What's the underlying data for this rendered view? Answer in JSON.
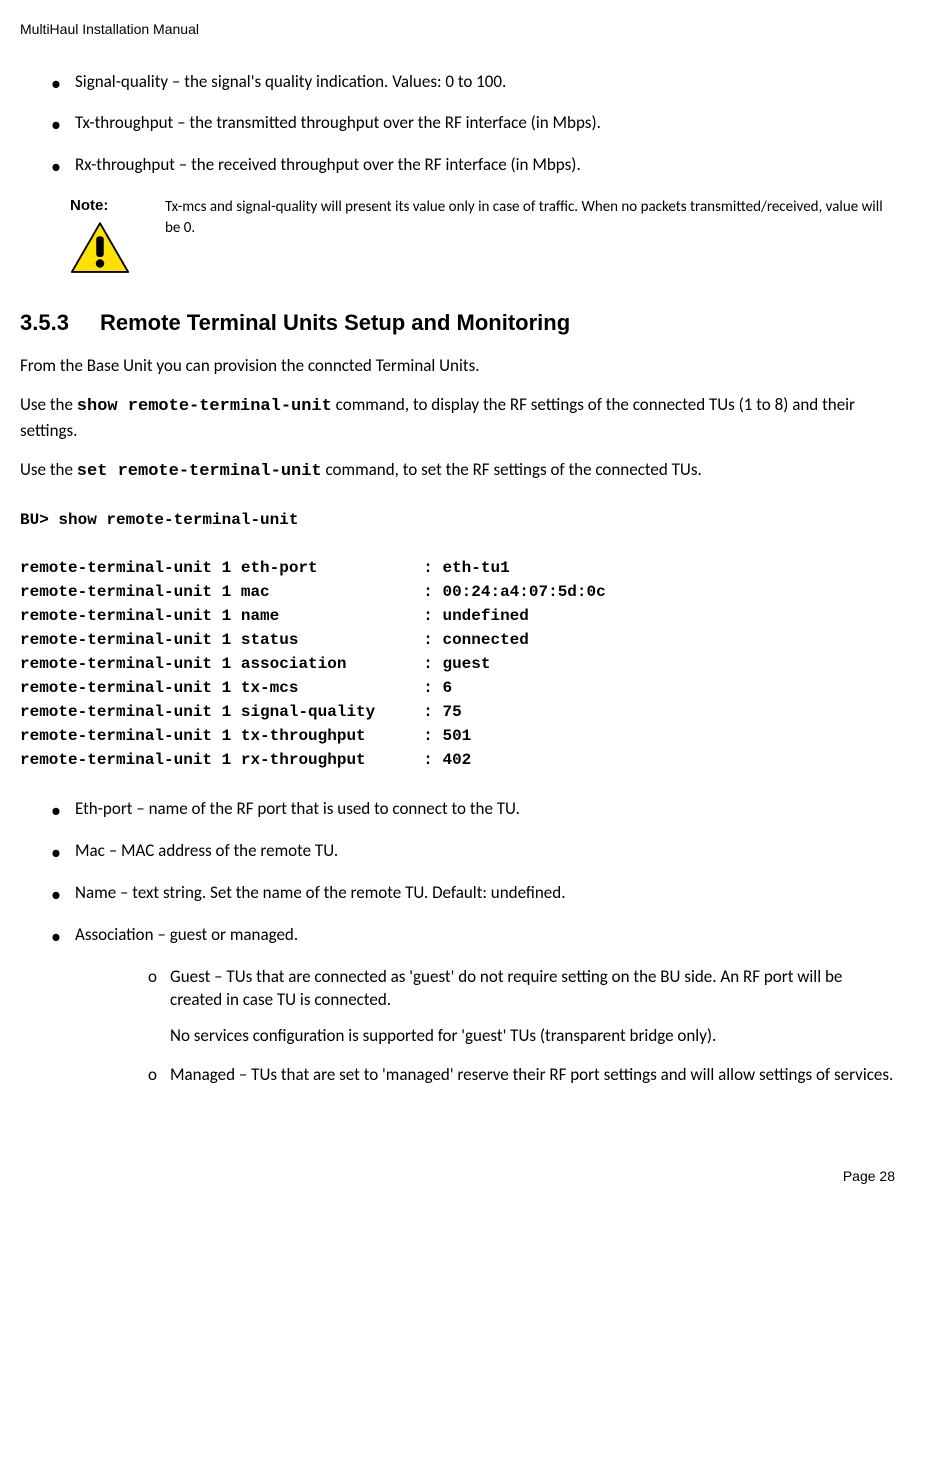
{
  "header": "MultiHaul Installation Manual",
  "top_bullets": [
    "Signal-quality – the signal's quality indication. Values: 0 to 100.",
    "Tx-throughput – the transmitted throughput over the RF interface (in Mbps).",
    "Rx-throughput – the received throughput over the RF interface (in Mbps)."
  ],
  "note": {
    "label": "Note:",
    "text": "Tx-mcs and signal-quality will present its value only in case of traffic. When no packets transmitted/received, value will be 0."
  },
  "section": {
    "number": "3.5.3",
    "title": "Remote Terminal Units Setup and Monitoring"
  },
  "paragraphs": {
    "intro": "From the Base Unit you can provision the conncted Terminal Units.",
    "p2_pre": "Use the ",
    "p2_cmd": "show remote-terminal-unit",
    "p2_post": " command, to display the RF settings of the connected TUs (1 to 8) and their settings.",
    "p3_pre": "Use the ",
    "p3_cmd": "set remote-terminal-unit",
    "p3_post": " command, to set the RF settings of the connected TUs."
  },
  "chart_data": {
    "type": "table",
    "prompt": "BU> show remote-terminal-unit",
    "rows": [
      {
        "field": "remote-terminal-unit 1 eth-port",
        "value": "eth-tu1"
      },
      {
        "field": "remote-terminal-unit 1 mac",
        "value": "00:24:a4:07:5d:0c"
      },
      {
        "field": "remote-terminal-unit 1 name",
        "value": "undefined"
      },
      {
        "field": "remote-terminal-unit 1 status",
        "value": "connected"
      },
      {
        "field": "remote-terminal-unit 1 association",
        "value": "guest"
      },
      {
        "field": "remote-terminal-unit 1 tx-mcs",
        "value": "6"
      },
      {
        "field": "remote-terminal-unit 1 signal-quality",
        "value": "75"
      },
      {
        "field": "remote-terminal-unit 1 tx-throughput",
        "value": "501"
      },
      {
        "field": "remote-terminal-unit 1 rx-throughput",
        "value": "402"
      }
    ]
  },
  "bottom_bullets": [
    "Eth-port – name of the RF port that is used to connect to the TU.",
    "Mac – MAC address of the remote TU.",
    "Name – text string. Set the name of the remote TU. Default: undefined.",
    "Association – guest or managed."
  ],
  "sub_items": {
    "guest_main": "Guest – TUs that are connected as 'guest' do not require setting on the BU side. An RF port will be created in case TU is connected.",
    "guest_extra": "No services configuration is supported for 'guest' TUs (transparent bridge only).",
    "managed": "Managed – TUs that are set to 'managed' reserve their RF port settings and will allow settings of services."
  },
  "footer": "Page 28"
}
